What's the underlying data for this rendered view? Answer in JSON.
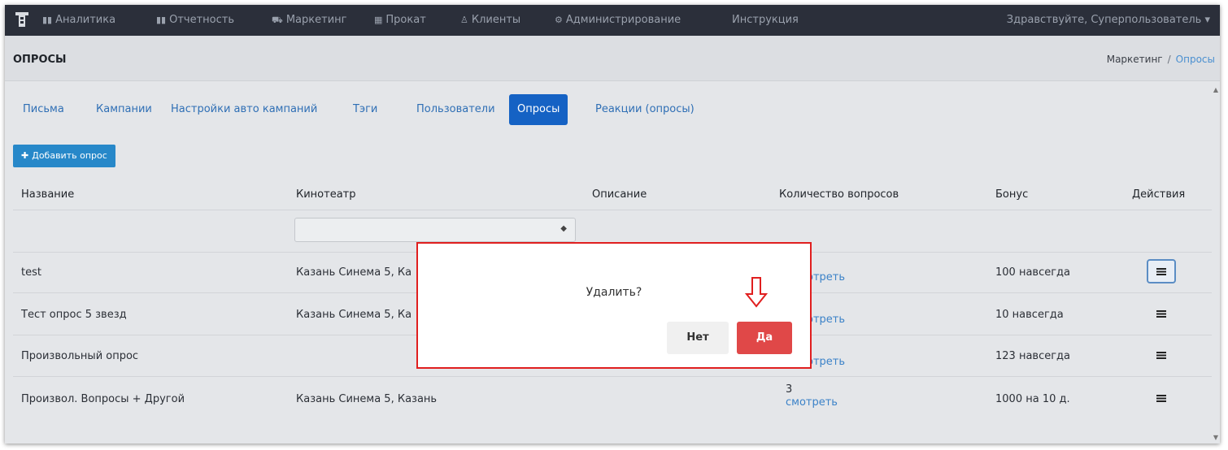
{
  "nav": {
    "items": [
      {
        "icon": "bar-chart-icon",
        "glyph": "▮▮",
        "label": "Аналитика"
      },
      {
        "icon": "bar-chart-icon",
        "glyph": "▮▮",
        "label": "Отчетность"
      },
      {
        "icon": "cart-icon",
        "glyph": "⛟",
        "label": "Маркетинг"
      },
      {
        "icon": "film-icon",
        "glyph": "▦",
        "label": "Прокат"
      },
      {
        "icon": "users-icon",
        "glyph": "♙",
        "label": "Клиенты"
      },
      {
        "icon": "gears-icon",
        "glyph": "⚙",
        "label": "Администрирование"
      },
      {
        "icon": "",
        "glyph": "",
        "label": "Инструкция"
      }
    ],
    "greeting": "Здравствуйте, Суперпользователь ▾"
  },
  "header": {
    "title": "ОПРОСЫ",
    "breadcrumb": {
      "parent": "Маркетинг",
      "separator": "/",
      "current": "Опросы"
    }
  },
  "tabs": [
    {
      "label": "Письма",
      "active": false
    },
    {
      "label": "Кампании",
      "active": false
    },
    {
      "label": "Настройки авто кампаний",
      "active": false
    },
    {
      "label": "Тэги",
      "active": false
    },
    {
      "label": "Пользователи",
      "active": false
    },
    {
      "label": "Опросы",
      "active": true
    },
    {
      "label": "Реакции (опросы)",
      "active": false
    }
  ],
  "add_button": {
    "label": "Добавить опрос"
  },
  "table": {
    "headers": {
      "name": "Название",
      "cinema": "Кинотеатр",
      "description": "Описание",
      "questions": "Количество вопросов",
      "bonus": "Бонус",
      "actions": "Действия"
    },
    "cinema_filter_value": "",
    "rows": [
      {
        "name": "test",
        "cinema": "Казань Синема 5, Ка",
        "questions_count": "",
        "questions_link": "отреть",
        "bonus": "100 навсегда"
      },
      {
        "name": "Тест опрос 5 звезд",
        "cinema": "Казань Синема 5, Ка",
        "questions_count": "",
        "questions_link": "отреть",
        "bonus": "10 навсегда"
      },
      {
        "name": "Произвольный опрос",
        "cinema": "",
        "questions_count": "",
        "questions_link": "отреть",
        "bonus": "123 навсегда"
      },
      {
        "name": "Произвол. Вопросы + Другой",
        "cinema": "Казань Синема 5, Казань",
        "questions_count": "3",
        "questions_link": "смотреть",
        "bonus": "1000 на 10 д."
      }
    ]
  },
  "modal": {
    "message": "Удалить?",
    "no_label": "Нет",
    "yes_label": "Да"
  },
  "colors": {
    "nav_bg": "#2b2f3a",
    "active_tab": "#1562c4",
    "add_button": "#2788c9",
    "yes_button": "#e04848",
    "modal_border": "#e01f1f",
    "link": "#3b82c8"
  }
}
